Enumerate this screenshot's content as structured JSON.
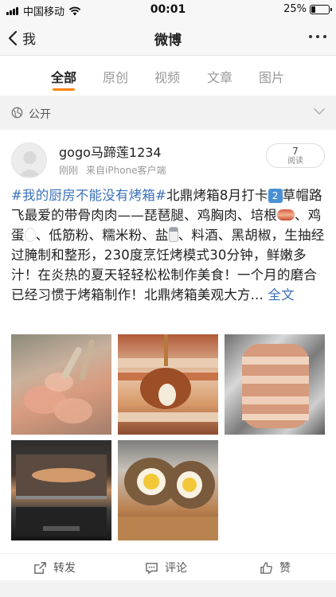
{
  "status_bar": {
    "carrier": "中国移动",
    "time": "00:01",
    "battery_percent": "25%",
    "battery_level": 0.25
  },
  "nav": {
    "back_label": "我",
    "title": "微博"
  },
  "tabs": [
    {
      "label": "全部",
      "active": true
    },
    {
      "label": "原创",
      "active": false
    },
    {
      "label": "视频",
      "active": false
    },
    {
      "label": "文章",
      "active": false
    },
    {
      "label": "图片",
      "active": false
    }
  ],
  "filter": {
    "label": "公开"
  },
  "post": {
    "username": "gogo马蹄莲1234",
    "time": "刚刚",
    "source": "来自iPhone客户端",
    "reads_count": "7",
    "reads_label": "阅读",
    "hashtag1": "#我的厨房不能没有烤箱#",
    "text1": "北鼎烤箱8月打卡",
    "badge": "2",
    "text2": "草帽路飞最爱的带骨肉肉——琵琶腿、鸡胸肉、培根",
    "text3": "、鸡蛋",
    "text4": "、低筋粉、糯米粉、盐",
    "text5": "、料酒、黑胡椒，生抽经过腌制和整形，230度烹饪烤模式30分钟，鲜嫩多汁！在炎热的夏天轻轻松松制作美食！一个月的磨合已经习惯于烤箱制作！北鼎烤箱美观大方...",
    "expand": "全文",
    "photos": [
      {
        "icon": "photo-chicken-legs"
      },
      {
        "icon": "photo-bacon-wrapped-egg"
      },
      {
        "icon": "photo-bacon-roll-foil"
      },
      {
        "icon": "photo-oven-roasting"
      },
      {
        "icon": "photo-cut-egg-roll"
      }
    ]
  },
  "actions": {
    "repost": "转发",
    "comment": "评论",
    "like": "赞"
  },
  "colors": {
    "accent": "#ff8200",
    "link": "#3b71b8",
    "badge": "#4a90d6"
  }
}
